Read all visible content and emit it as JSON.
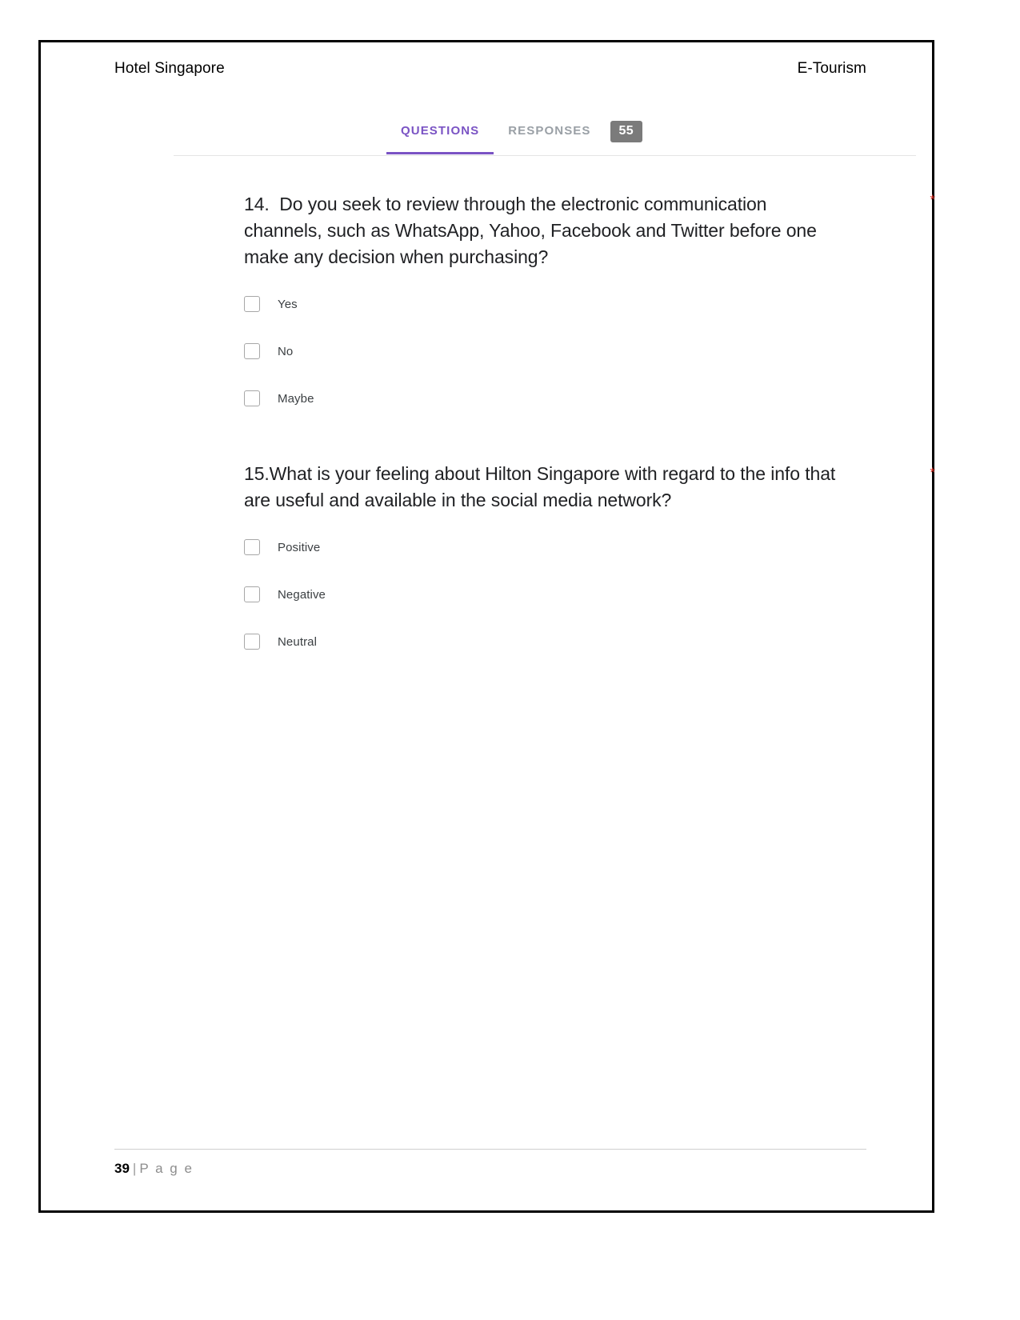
{
  "document": {
    "header": {
      "left_title": "Hotel Singapore",
      "right_title": "E-Tourism"
    },
    "footer": {
      "page_number": "39",
      "separator": "|",
      "page_word": "P a g e"
    }
  },
  "form": {
    "tabs": [
      {
        "label": "QUESTIONS",
        "active": true
      },
      {
        "label": "RESPONSES",
        "active": false
      }
    ],
    "responses_badge": "55",
    "accent_color": "#7a53c4",
    "badge_color": "#7b7b7b",
    "required_marker": "*",
    "questions": [
      {
        "text": "14.  Do you seek to review through the electronic communication channels, such as WhatsApp, Yahoo, Facebook and Twitter before one make any decision when purchasing?",
        "required": true,
        "options": [
          {
            "label": "Yes",
            "checked": false
          },
          {
            "label": "No",
            "checked": false
          },
          {
            "label": "Maybe",
            "checked": false
          }
        ]
      },
      {
        "text": "15.What is your feeling about Hilton Singapore with regard to the info that are useful and available in the social media network?",
        "required": true,
        "options": [
          {
            "label": "Positive",
            "checked": false
          },
          {
            "label": "Negative",
            "checked": false
          },
          {
            "label": "Neutral",
            "checked": false
          }
        ]
      }
    ]
  }
}
